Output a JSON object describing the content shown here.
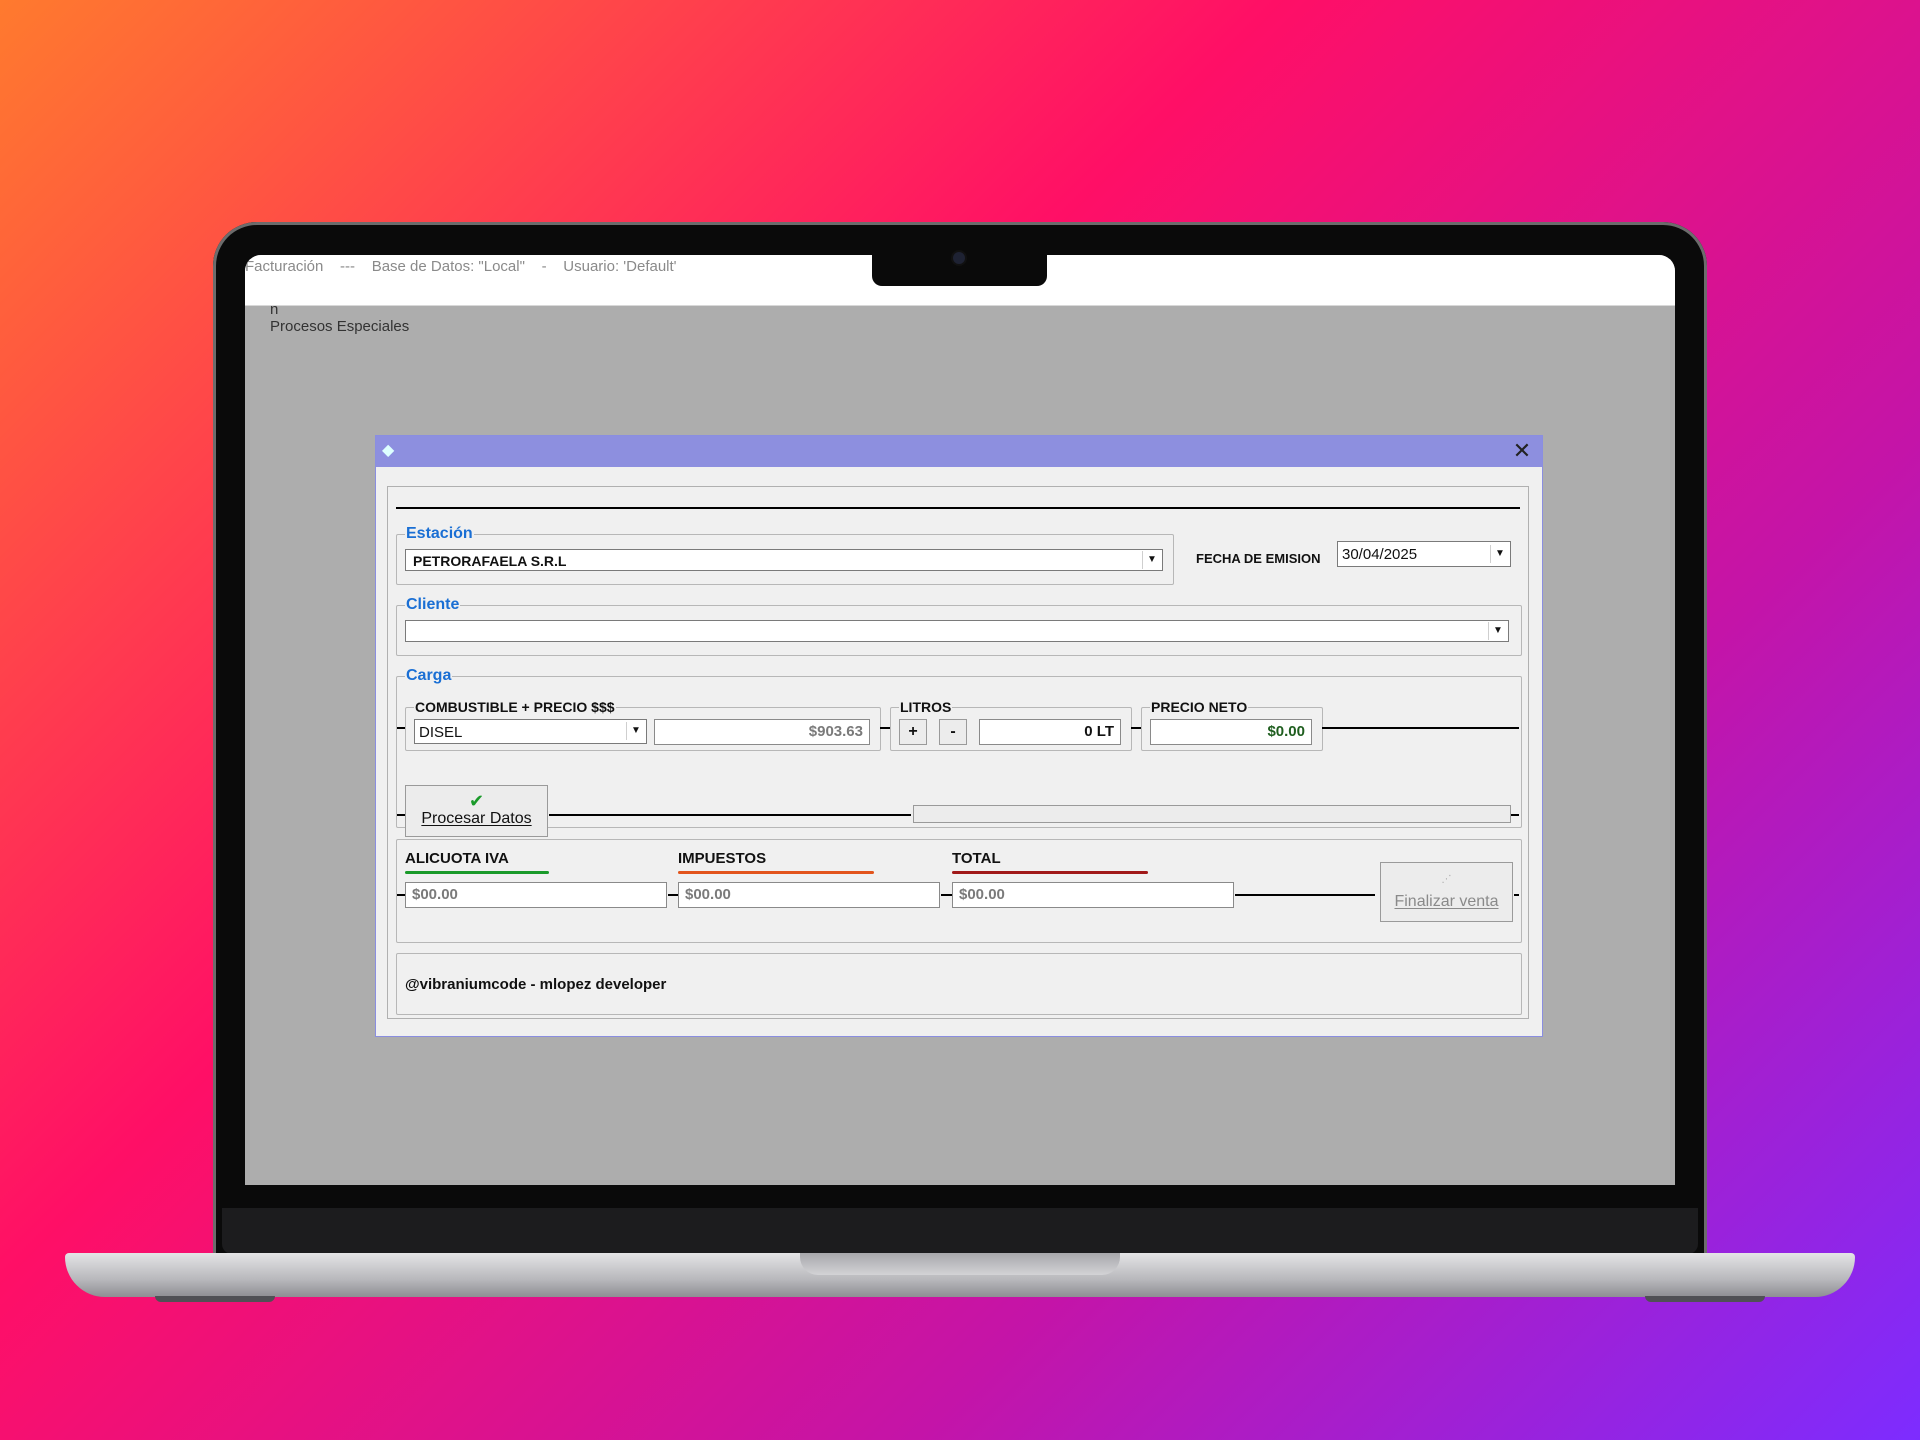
{
  "app": {
    "title": "Facturación    ---    Base de Datos: \"Local\"    -    Usuario: 'Default'",
    "menu": [
      "n",
      "Procesos Especiales"
    ]
  },
  "dialog": {
    "estacion": {
      "legend": "Estación",
      "value": "PETRORAFAELA S.R.L"
    },
    "fecha": {
      "label": "FECHA DE EMISION",
      "value": "30/04/2025"
    },
    "cliente": {
      "legend": "Cliente",
      "value": ""
    },
    "carga": {
      "legend": "Carga",
      "combustible_legend": "COMBUSTIBLE + PRECIO $$$",
      "combustible": "DISEL",
      "precio": "$903.63",
      "litros_legend": "LITROS",
      "plus": "+",
      "minus": "-",
      "litros": "0 LT",
      "neto_legend": "PRECIO NETO",
      "neto": "$0.00",
      "procesar_label": "Procesar Datos"
    },
    "totales": {
      "iva_label": "ALICUOTA IVA",
      "iva": "$00.00",
      "impuestos_label": "IMPUESTOS",
      "impuestos": "$00.00",
      "total_label": "TOTAL",
      "total": "$00.00",
      "finalizar_label": "Finalizar venta"
    },
    "footer": "@vibraniumcode - mlopez developer"
  },
  "colors": {
    "title_bar": "#8d8fdf",
    "legend_blue": "#1a6fd4",
    "iva_line": "#1a9a2a",
    "impuestos_line": "#e2541c",
    "total_line": "#a01818",
    "neto_text": "#1f5e1f"
  },
  "icons": [
    "app-icon",
    "close-icon",
    "dropdown-arrow-icon",
    "checkmark-icon"
  ]
}
